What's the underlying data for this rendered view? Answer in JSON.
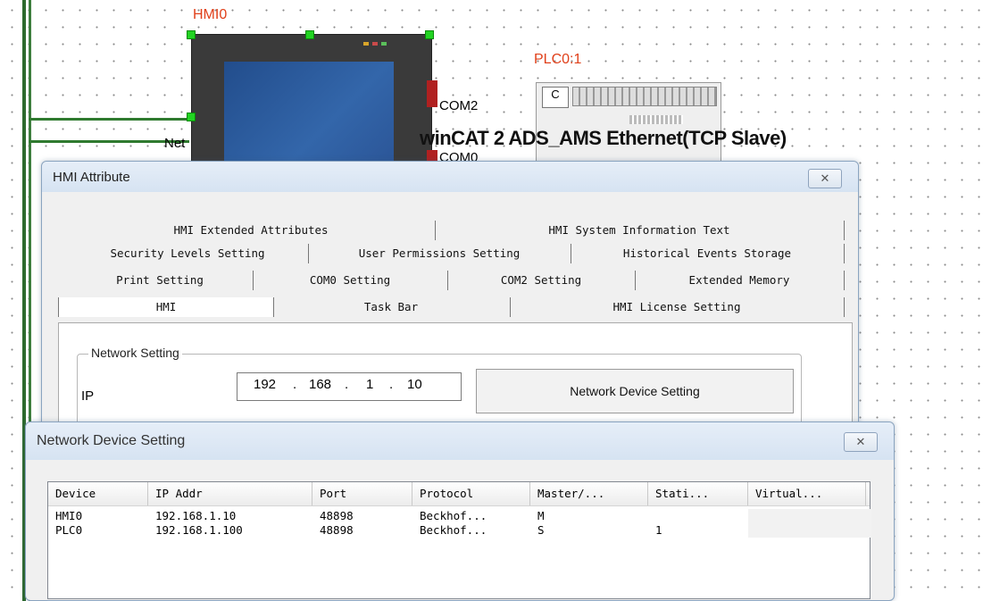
{
  "canvas": {
    "hmi_label": "HMI0",
    "plc_label": "PLC0:1",
    "com2_label": "COM2",
    "com0_label": "COM0",
    "net_label": "Net",
    "connection_caption": "winCAT 2 ADS_AMS Ethernet(TCP Slave)"
  },
  "hmi_attribute": {
    "title": "HMI Attribute",
    "close_glyph": "✕",
    "tab_rows": [
      [
        "HMI Extended Attributes",
        "HMI System Information Text"
      ],
      [
        "Security Levels Setting",
        "User Permissions Setting",
        "Historical Events Storage"
      ],
      [
        "Print Setting",
        "COM0 Setting",
        "COM2 Setting",
        "Extended Memory"
      ],
      [
        "HMI",
        "Task Bar",
        "HMI License Setting"
      ]
    ],
    "network_group": {
      "legend": "Network Setting",
      "ip_label": "IP",
      "ip_octets": [
        "192",
        "168",
        "1",
        "10"
      ],
      "device_button": "Network Device Setting"
    }
  },
  "network_device": {
    "title": "Network Device Setting",
    "close_glyph": "✕",
    "columns": [
      "Device",
      "IP Addr",
      "Port",
      "Protocol",
      "Master/...",
      "Stati...",
      "Virtual..."
    ],
    "rows": [
      [
        "HMI0",
        "192.168.1.10",
        "48898",
        "Beckhof...",
        "M",
        "",
        ""
      ],
      [
        "PLC0",
        "192.168.1.100",
        "48898",
        "Beckhof...",
        "S",
        "1",
        ""
      ]
    ]
  }
}
